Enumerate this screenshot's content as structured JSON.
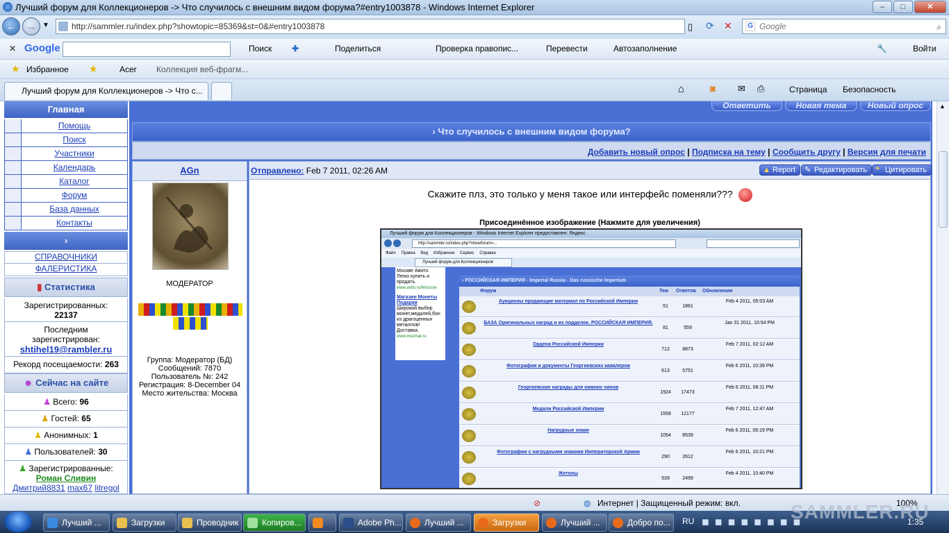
{
  "window": {
    "title": "Лучший форум для Коллекционеров -> Что случилось с внешним видом форума?#entry1003878 - Windows Internet Explorer",
    "minimize": "–",
    "maximize": "□",
    "close": "✕"
  },
  "address": {
    "url": "http://sammler.ru/index.php?showtopic=85369&st=0&#entry1003878",
    "search_placeholder": "Google"
  },
  "google_toolbar": {
    "logo": "Google",
    "search": "Поиск",
    "share": "Поделиться",
    "spell": "Проверка правопис...",
    "translate": "Перевести",
    "autofill": "Автозаполнение",
    "signin": "Войти"
  },
  "favorites": {
    "favorites": "Избранное",
    "acer": "Acer",
    "webslices": "Коллекция веб-фрагм..."
  },
  "tabs": {
    "active": "Лучший форум для Коллекционеров -> Что с...",
    "page": "Страница",
    "safety": "Безопасность"
  },
  "sidebar": {
    "main": "Главная",
    "items": [
      {
        "label": "Помощь"
      },
      {
        "label": "Поиск"
      },
      {
        "label": "Участники"
      },
      {
        "label": "Календарь"
      },
      {
        "label": "Каталог"
      },
      {
        "label": "Форум"
      },
      {
        "label": "База данных"
      },
      {
        "label": "Контакты"
      }
    ],
    "arrow": "›",
    "links": [
      "СПРАВОЧНИКИ",
      "ФАЛЕРИСТИКА"
    ],
    "stats_title": "Статистика",
    "registered_label": "Зарегистрированных:",
    "registered_value": "22137",
    "last_label": "Последним зарегистрирован:",
    "last_user": "shtihel19@rambler.ru",
    "record_label": "Рекорд посещаемости:",
    "record_value": "263",
    "online_title": "Сейчас на сайте",
    "total_label": "Всего:",
    "total_value": "96",
    "guests_label": "Гостей:",
    "guests_value": "65",
    "anon_label": "Анонимных:",
    "anon_value": "1",
    "users_label": "Пользователей:",
    "users_value": "30",
    "reg_label": "Зарегистрированные:",
    "reg_user1": "Роман Сливин",
    "reg_users_more": [
      "Дмитрий8831",
      "max67",
      "litregol"
    ]
  },
  "forum": {
    "btn_reply": "Ответить",
    "btn_newtopic": "Новая тема",
    "btn_newpoll": "Новый опрос",
    "topic_title": "› Что случилось с внешним видом форума?",
    "opts": [
      "Добавить новый опрос",
      "Подписка на тему",
      "Сообщить другу",
      "Версия для печати"
    ],
    "opts_sep": "|",
    "author": "AGn",
    "sent_label": "Отправлено:",
    "sent_date": "Feb 7 2011, 02:26 AM",
    "btn_report": "Report",
    "btn_edit": "Редактировать",
    "btn_quote": "Цитировать",
    "role": "МОДЕРАТОР",
    "group": "Группа: Модератор (БД)",
    "posts": "Сообщений: 7870",
    "member_no": "Пользователь №: 242",
    "registration": "Регистрация: 8-December 04",
    "location": "Место жительства: Москва",
    "message": "Скажите плз, это только у меня такое или интерфейс поменяли???",
    "attach_caption": "Присоединённое изображение (Нажмите для увеличения)"
  },
  "mini_screenshot": {
    "title": "Лучший форум для Коллекционеров - Windows Internet Explorer предоставлен: Яндекс",
    "url": "http://sammler.ru/index.php?showforum=...",
    "menu": [
      "Файл",
      "Правка",
      "Вид",
      "Избранное",
      "Сервис",
      "Справка"
    ],
    "tab": "Лучший форум для Коллекционеров",
    "ad_lines": [
      "Москве Авито.",
      "Легко купить и",
      "продать.",
      "www.avito.ru/Moscow"
    ],
    "ad2_title": "Магазин Монеты Подарки",
    "ad2_lines": [
      "Широкий выбор",
      "монет,медалей,бон",
      "из драгоценных",
      "металлов!",
      "Доставка.",
      "www.mezmat.ru"
    ],
    "section": "› РОССИЙСКАЯ ИМПЕРИЯ - Imperial Russia - Das russische Imperium",
    "cols": [
      "Форум",
      "Тем",
      "Ответов",
      "Обновления"
    ],
    "rows": [
      {
        "title": "Аукционы продающие материал по Российской Империи",
        "t": "51",
        "r": "1861",
        "upd": "Feb 4 2011, 05:03 AM"
      },
      {
        "title": "БАЗА Оригинальных наград и их подделок. РОССИЙСКАЯ ИМПЕРИЯ.",
        "t": "81",
        "r": "559",
        "upd": "Jan 31 2011, 10:54 PM"
      },
      {
        "title": "Ордена Российской Империи",
        "t": "712",
        "r": "8873",
        "upd": "Feb 7 2011, 02:12 AM"
      },
      {
        "title": "Фотографии и документы Георгиевских кавалеров",
        "t": "613",
        "r": "5751",
        "upd": "Feb 6 2011, 10:39 PM"
      },
      {
        "title": "Георгиевские награды для нижних чинов",
        "t": "1924",
        "r": "17473",
        "upd": "Feb 6 2011, 08:11 PM"
      },
      {
        "title": "Медали Российской Империи",
        "t": "1559",
        "r": "12177",
        "upd": "Feb 7 2011, 12:47 AM"
      },
      {
        "title": "Нагрудные знаки",
        "t": "1054",
        "r": "8539",
        "upd": "Feb 6 2011, 09:19 PM"
      },
      {
        "title": "Фотографии с нагрудными знаками Императорской Армии",
        "t": "290",
        "r": "2612",
        "upd": "Feb 6 2011, 10:21 PM"
      },
      {
        "title": "Жетоны",
        "t": "539",
        "r": "2499",
        "upd": "Feb 4 2011, 10:40 PM"
      }
    ]
  },
  "statusbar": {
    "zone": "Интернет | Защищенный режим: вкл.",
    "zoom": "100%"
  },
  "taskbar": {
    "items": [
      "Лучший ...",
      "Загрузки",
      "Проводник",
      "Копиров...",
      "",
      "Adobe Ph...",
      "Лучший ...",
      "Загрузки",
      "Лучший ...",
      "Добро по..."
    ],
    "lang": "RU",
    "clock": "1:35"
  },
  "watermark": "SAMMLER.RU",
  "colors": {
    "forum_blue": "#4a70d6",
    "link": "#1a3cb8"
  }
}
